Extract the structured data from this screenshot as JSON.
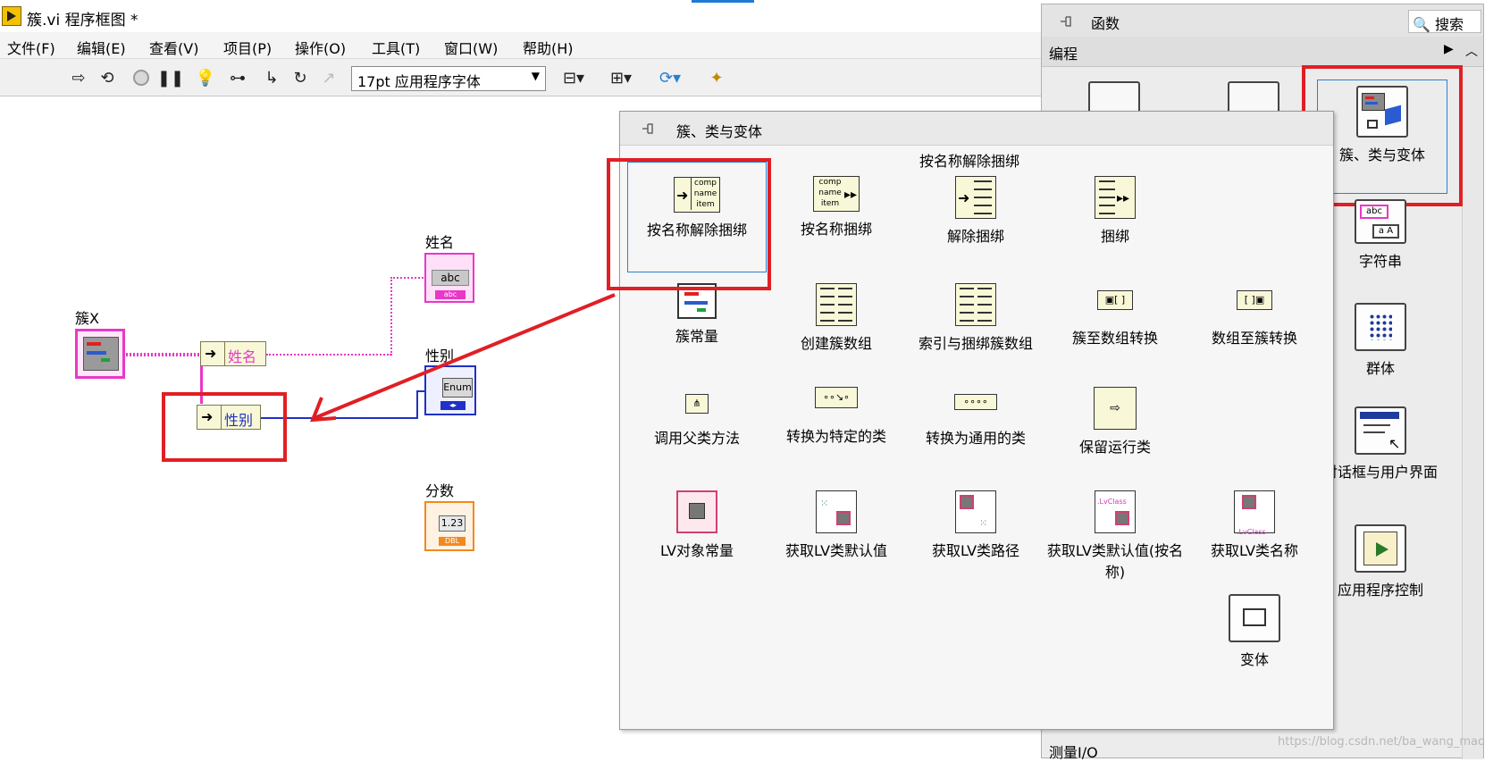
{
  "window": {
    "title": "簇.vi 程序框图 *"
  },
  "menu": [
    "文件(F)",
    "编辑(E)",
    "查看(V)",
    "项目(P)",
    "操作(O)",
    "工具(T)",
    "窗口(W)",
    "帮助(H)"
  ],
  "toolbar": {
    "font_select": "17pt 应用程序字体"
  },
  "diagram": {
    "cluster_label": "簇X",
    "name_label": "姓名",
    "gender_label": "性别",
    "score_label": "分数",
    "unbundle_name": "姓名",
    "unbundle_gender": "性别",
    "abc": "abc",
    "abc_sub": "abc",
    "enum": "Enum",
    "num": "1.23",
    "num_sub": "DBL",
    "colors": {
      "string": "#e838c8",
      "enum": "#2030c8",
      "double": "#f08a1e",
      "cluster": "#e838c8",
      "highlight": "#e01f24"
    }
  },
  "functions_palette": {
    "title": "函数",
    "search_label": "搜索",
    "category": "编程",
    "bottom_category": "测量I/O",
    "items": [
      "簇、类与变体",
      "字符串",
      "群体",
      "对话框与用户界面",
      "应用程序控制"
    ]
  },
  "sub_palette": {
    "title": "簇、类与变体",
    "tooltip": "按名称解除捆绑",
    "items": [
      "按名称解除捆绑",
      "按名称捆绑",
      "解除捆绑",
      "捆绑",
      "簇常量",
      "创建簇数组",
      "索引与捆绑簇数组",
      "簇至数组转换",
      "数组至簇转换",
      "调用父类方法",
      "转换为特定的类",
      "转换为通用的类",
      "保留运行类",
      "LV对象常量",
      "获取LV类默认值",
      "获取LV类路径",
      "获取LV类默认值(按名称)",
      "获取LV类名称",
      "变体"
    ]
  },
  "watermark": "https://blog.csdn.net/ba_wang_mao"
}
